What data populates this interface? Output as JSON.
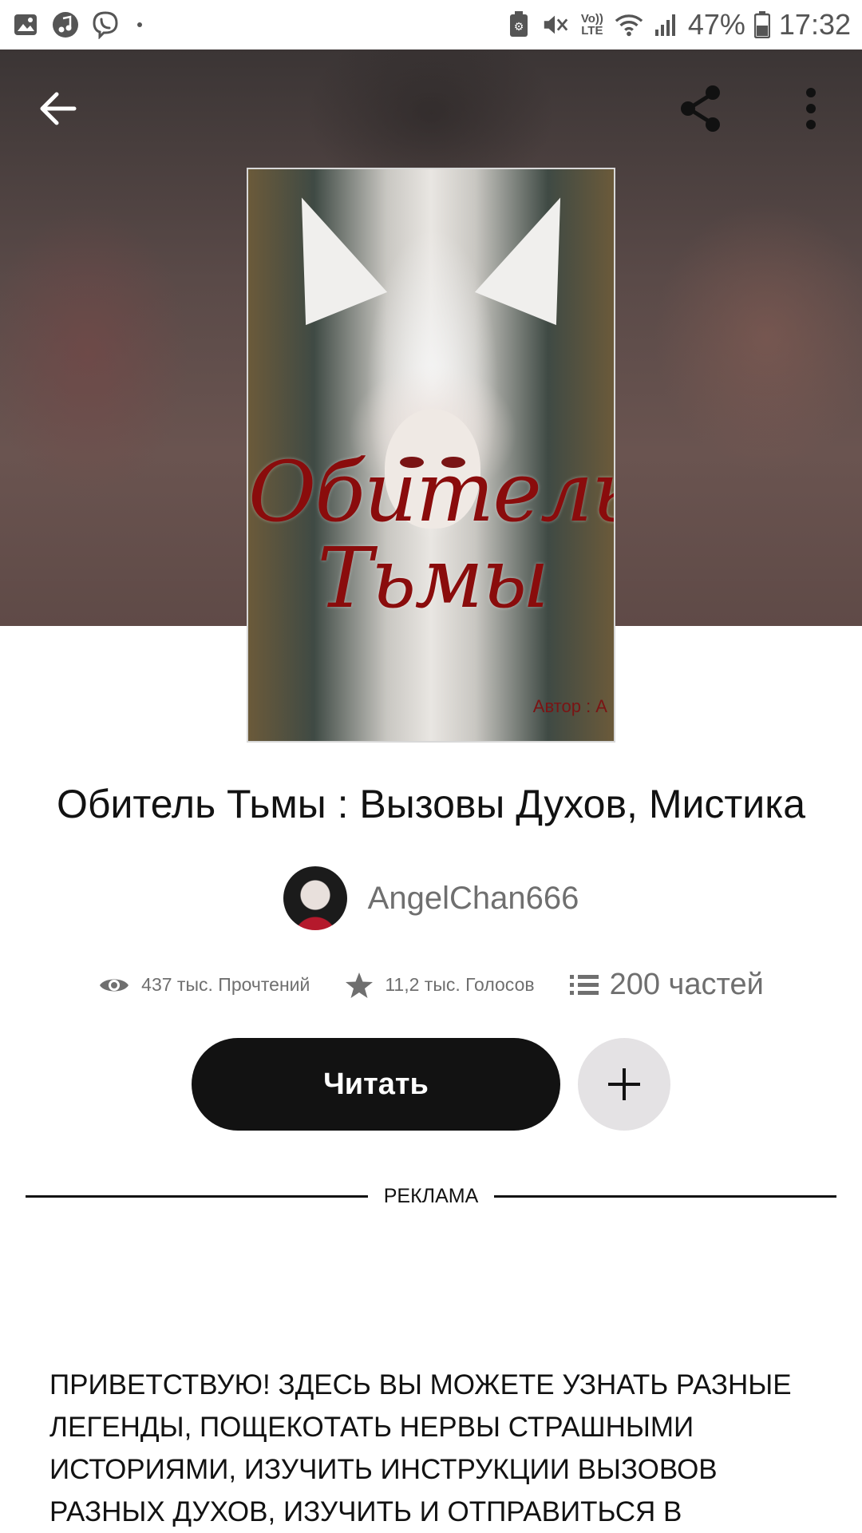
{
  "status_bar": {
    "battery": "47%",
    "time": "17:32",
    "lte_top": "Vo))",
    "lte_bottom": "LTE",
    "icons": [
      "gallery-icon",
      "music-icon",
      "viber-icon",
      "dot-icon",
      "silent-icon",
      "vibrate-mute-icon",
      "volte-icon",
      "wifi-icon",
      "signal-icon",
      "battery-icon"
    ]
  },
  "header": {
    "icons": [
      "back-arrow-icon",
      "share-icon",
      "more-vertical-icon"
    ]
  },
  "cover": {
    "title_line1": "Обитель",
    "title_line2": "Тьмы",
    "author_tag": "Автор : А"
  },
  "book": {
    "title": "Обитель Тьмы : Вызовы Духов, Мистика",
    "author": "AngelChan666"
  },
  "stats": {
    "reads": "437 тыс. Прочтений",
    "votes": "11,2 тыс. Голосов",
    "parts": "200 частей"
  },
  "actions": {
    "read_label": "Читать",
    "add_icon": "plus-icon"
  },
  "ad": {
    "label": "РЕКЛАМА"
  },
  "description": {
    "text": "ПРИВЕТСТВУЮ! ЗДЕСЬ ВЫ МОЖЕТЕ УЗНАТЬ РАЗНЫЕ ЛЕГЕНДЫ, ПОЩЕКОТАТЬ НЕРВЫ СТРАШНЫМИ ИСТОРИЯМИ, ИЗУЧИТЬ ИНСТРУКЦИИ ВЫЗОВОВ РАЗНЫХ ДУХОВ, ИЗУЧИТЬ И ОТПРАВИТЬСЯ В"
  },
  "colors": {
    "primary_button": "#121212",
    "secondary_button": "#e4e2e4",
    "muted_text": "#6f6f6f",
    "cover_title": "#8a0c0c"
  }
}
